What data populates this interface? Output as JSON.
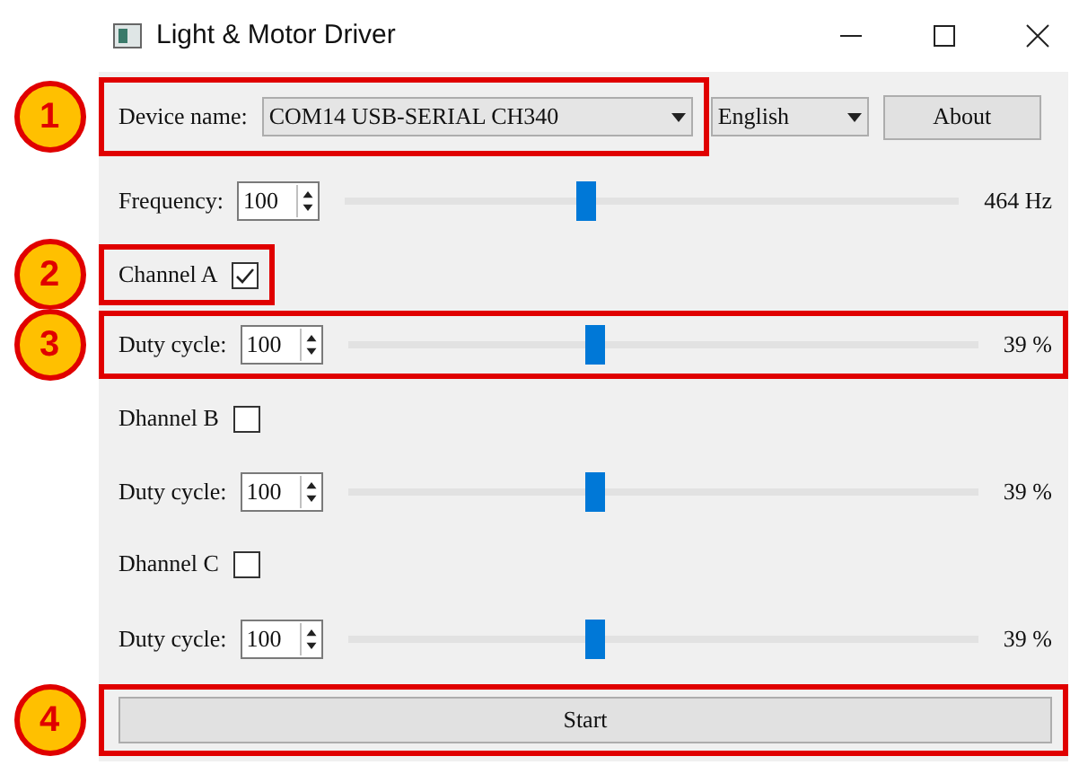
{
  "window": {
    "title": "Light & Motor Driver"
  },
  "device": {
    "label": "Device name:",
    "value": "COM14 USB-SERIAL CH340",
    "callout": "1"
  },
  "language": {
    "value": "English"
  },
  "about_button": {
    "label": "About"
  },
  "frequency": {
    "label": "Frequency:",
    "value": "100",
    "level": 0.39,
    "reading": "464 Hz"
  },
  "channels": [
    {
      "label": "Channel A",
      "checked": true,
      "callout": "2",
      "duty": {
        "label": "Duty cycle:",
        "value": "100",
        "level": 0.39,
        "reading": "39 %",
        "callout": "3"
      }
    },
    {
      "label": "Dhannel B",
      "checked": false,
      "duty": {
        "label": "Duty cycle:",
        "value": "100",
        "level": 0.39,
        "reading": "39 %"
      }
    },
    {
      "label": "Dhannel C",
      "checked": false,
      "duty": {
        "label": "Duty cycle:",
        "value": "100",
        "level": 0.39,
        "reading": "39 %"
      }
    }
  ],
  "start_button": {
    "label": "Start",
    "callout": "4"
  }
}
